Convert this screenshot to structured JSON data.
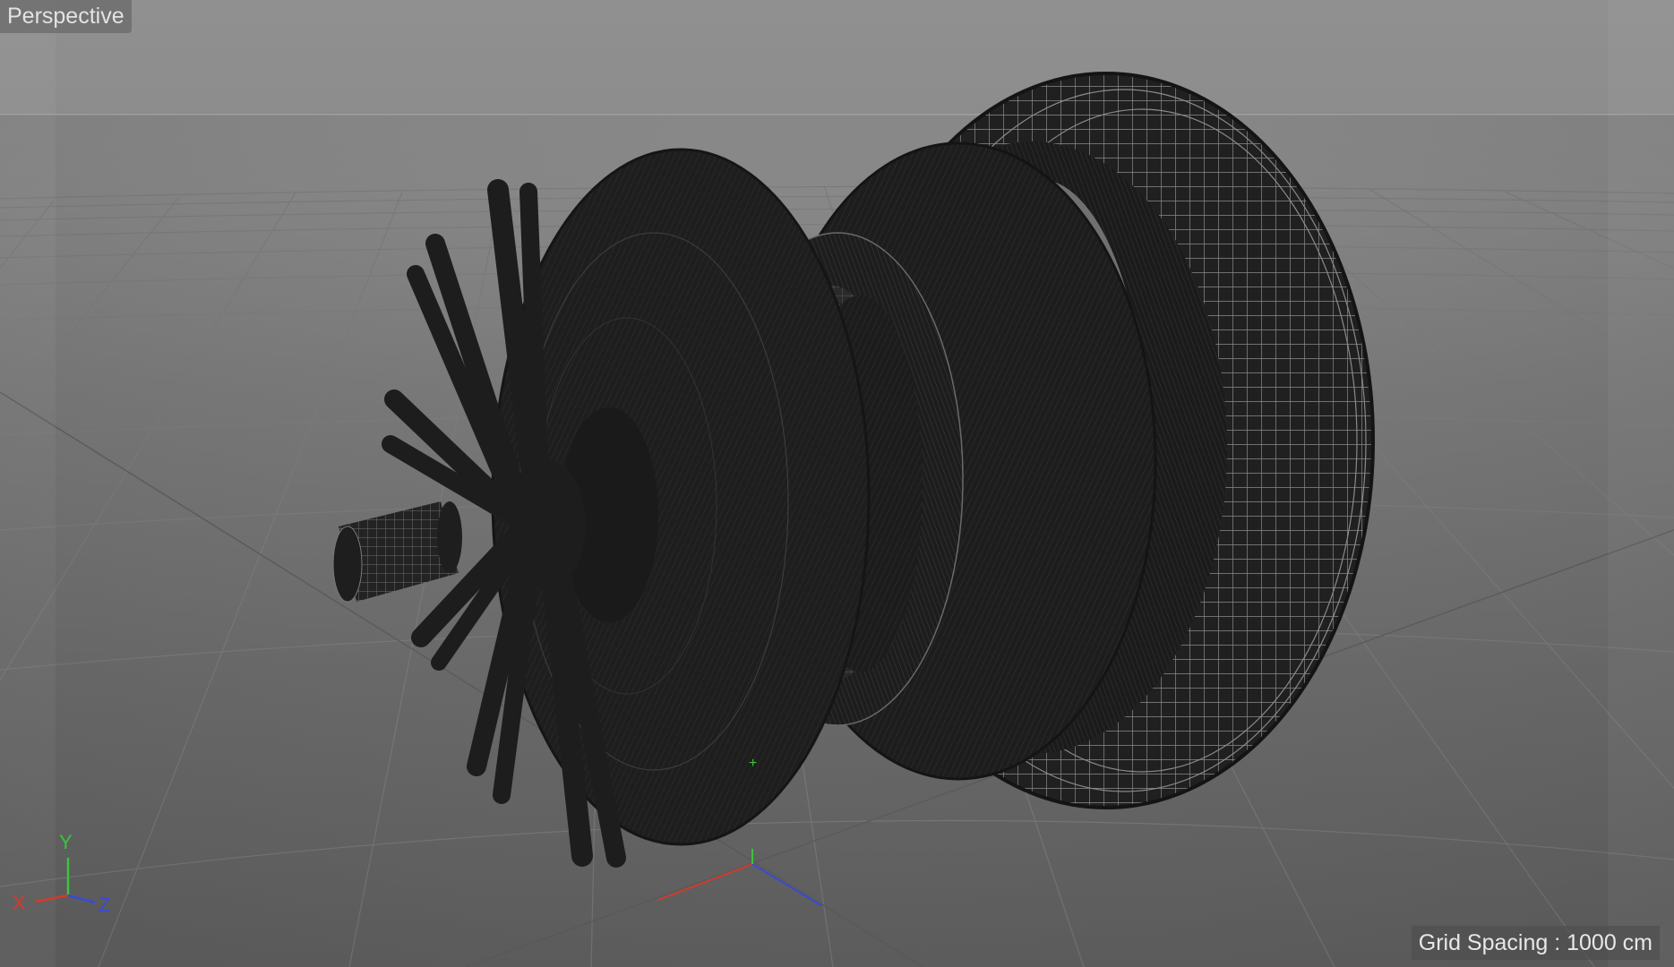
{
  "viewport": {
    "name": "Perspective",
    "grid_spacing_label": "Grid Spacing : 1000 cm"
  },
  "axis_gizmo": {
    "x_label": "X",
    "y_label": "Y",
    "z_label": "Z",
    "x_color": "#d43a2a",
    "y_color": "#3cc43c",
    "z_color": "#3a4ad4"
  },
  "colors": {
    "background_top": "#909090",
    "background_bottom": "#5f5f5f",
    "grid_line": "#7c7c7c",
    "mesh_fill": "#1d1d1d",
    "wireframe": "#8a8a8a"
  }
}
